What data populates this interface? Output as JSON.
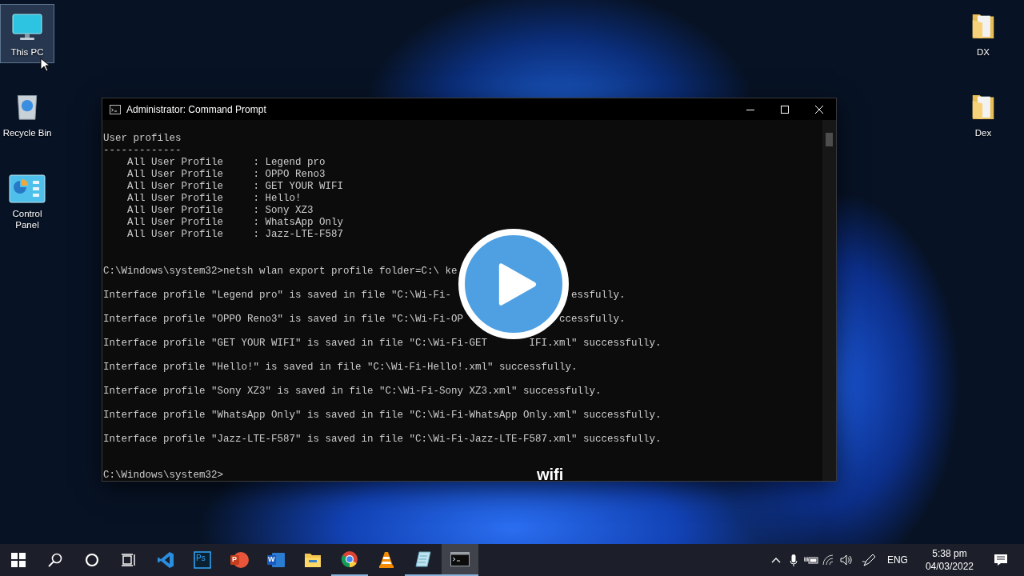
{
  "desktop_icons_left": [
    {
      "kind": "computer",
      "label": "This PC",
      "selected": true
    },
    {
      "kind": "recycle-bin",
      "label": "Recycle Bin",
      "selected": false
    },
    {
      "kind": "control-panel",
      "label": "Control Panel",
      "selected": false
    }
  ],
  "desktop_icons_right": [
    {
      "kind": "folder",
      "label": "DX",
      "selected": false
    },
    {
      "kind": "folder",
      "label": "Dex",
      "selected": false
    }
  ],
  "window": {
    "title": "Administrator: Command Prompt",
    "lines": [
      {
        "kind": "heading",
        "segments": [
          "User profiles"
        ]
      },
      {
        "kind": "rule",
        "segments": [
          "-------------"
        ]
      },
      {
        "kind": "entry",
        "segments": [
          "All User Profile     : Legend pro"
        ]
      },
      {
        "kind": "entry",
        "segments": [
          "All User Profile     : OPPO Reno3"
        ]
      },
      {
        "kind": "entry",
        "segments": [
          "All User Profile     : GET YOUR WIFI"
        ]
      },
      {
        "kind": "entry",
        "segments": [
          "All User Profile     : Hello!"
        ]
      },
      {
        "kind": "entry",
        "segments": [
          "All User Profile     : Sony XZ3"
        ]
      },
      {
        "kind": "entry",
        "segments": [
          "All User Profile     : WhatsApp Only"
        ]
      },
      {
        "kind": "entry",
        "segments": [
          "All User Profile     : Jazz-LTE-F587"
        ]
      },
      {
        "kind": "command",
        "segments": [
          "C:\\Windows\\system32>netsh wlan export profile folder=C:\\ ke"
        ]
      },
      {
        "kind": "result",
        "segments": [
          "Interface profile \"Legend pro\" is saved in file \"C:\\Wi-Fi-",
          "essfully."
        ]
      },
      {
        "kind": "result",
        "segments": [
          "Interface profile \"OPPO Reno3\" is saved in file \"C:\\Wi-Fi-OP",
          "ccessfully."
        ]
      },
      {
        "kind": "result",
        "segments": [
          "Interface profile \"GET YOUR WIFI\" is saved in file \"C:\\Wi-Fi-GET",
          "IFI.xml\" successfully."
        ]
      },
      {
        "kind": "result",
        "segments": [
          "Interface profile \"Hello!\" is saved in file \"C:\\Wi-Fi-Hello!.xml\" successfully."
        ]
      },
      {
        "kind": "result",
        "segments": [
          "Interface profile \"Sony XZ3\" is saved in file \"C:\\Wi-Fi-Sony XZ3.xml\" successfully."
        ]
      },
      {
        "kind": "result",
        "segments": [
          "Interface profile \"WhatsApp Only\" is saved in file \"C:\\Wi-Fi-WhatsApp Only.xml\" successfully."
        ]
      },
      {
        "kind": "result",
        "segments": [
          "Interface profile \"Jazz-LTE-F587\" is saved in file \"C:\\Wi-Fi-Jazz-LTE-F587.xml\" successfully."
        ]
      },
      {
        "kind": "prompt",
        "segments": [
          "C:\\Windows\\system32>"
        ]
      }
    ]
  },
  "video_overlay": {
    "caption": "wifi"
  },
  "taskbar": {
    "apps": [
      {
        "kind": "start",
        "running": false,
        "active": false
      },
      {
        "kind": "search",
        "running": false,
        "active": false
      },
      {
        "kind": "cortana",
        "running": false,
        "active": false
      },
      {
        "kind": "task-view",
        "running": false,
        "active": false
      },
      {
        "kind": "code-editor",
        "running": false,
        "active": false
      },
      {
        "kind": "photoshop",
        "letter": "Ps",
        "running": false,
        "active": false
      },
      {
        "kind": "powerpoint",
        "letter": "P",
        "running": false,
        "active": false
      },
      {
        "kind": "word",
        "letter": "W",
        "running": false,
        "active": false
      },
      {
        "kind": "file-explorer",
        "running": false,
        "active": false
      },
      {
        "kind": "chrome",
        "running": true,
        "active": false
      },
      {
        "kind": "vlc",
        "running": false,
        "active": false
      },
      {
        "kind": "notepad",
        "running": true,
        "active": false
      },
      {
        "kind": "terminal",
        "running": true,
        "active": true
      }
    ],
    "tray": {
      "language": "ENG",
      "time": "5:38 pm",
      "date": "04/03/2022"
    }
  }
}
